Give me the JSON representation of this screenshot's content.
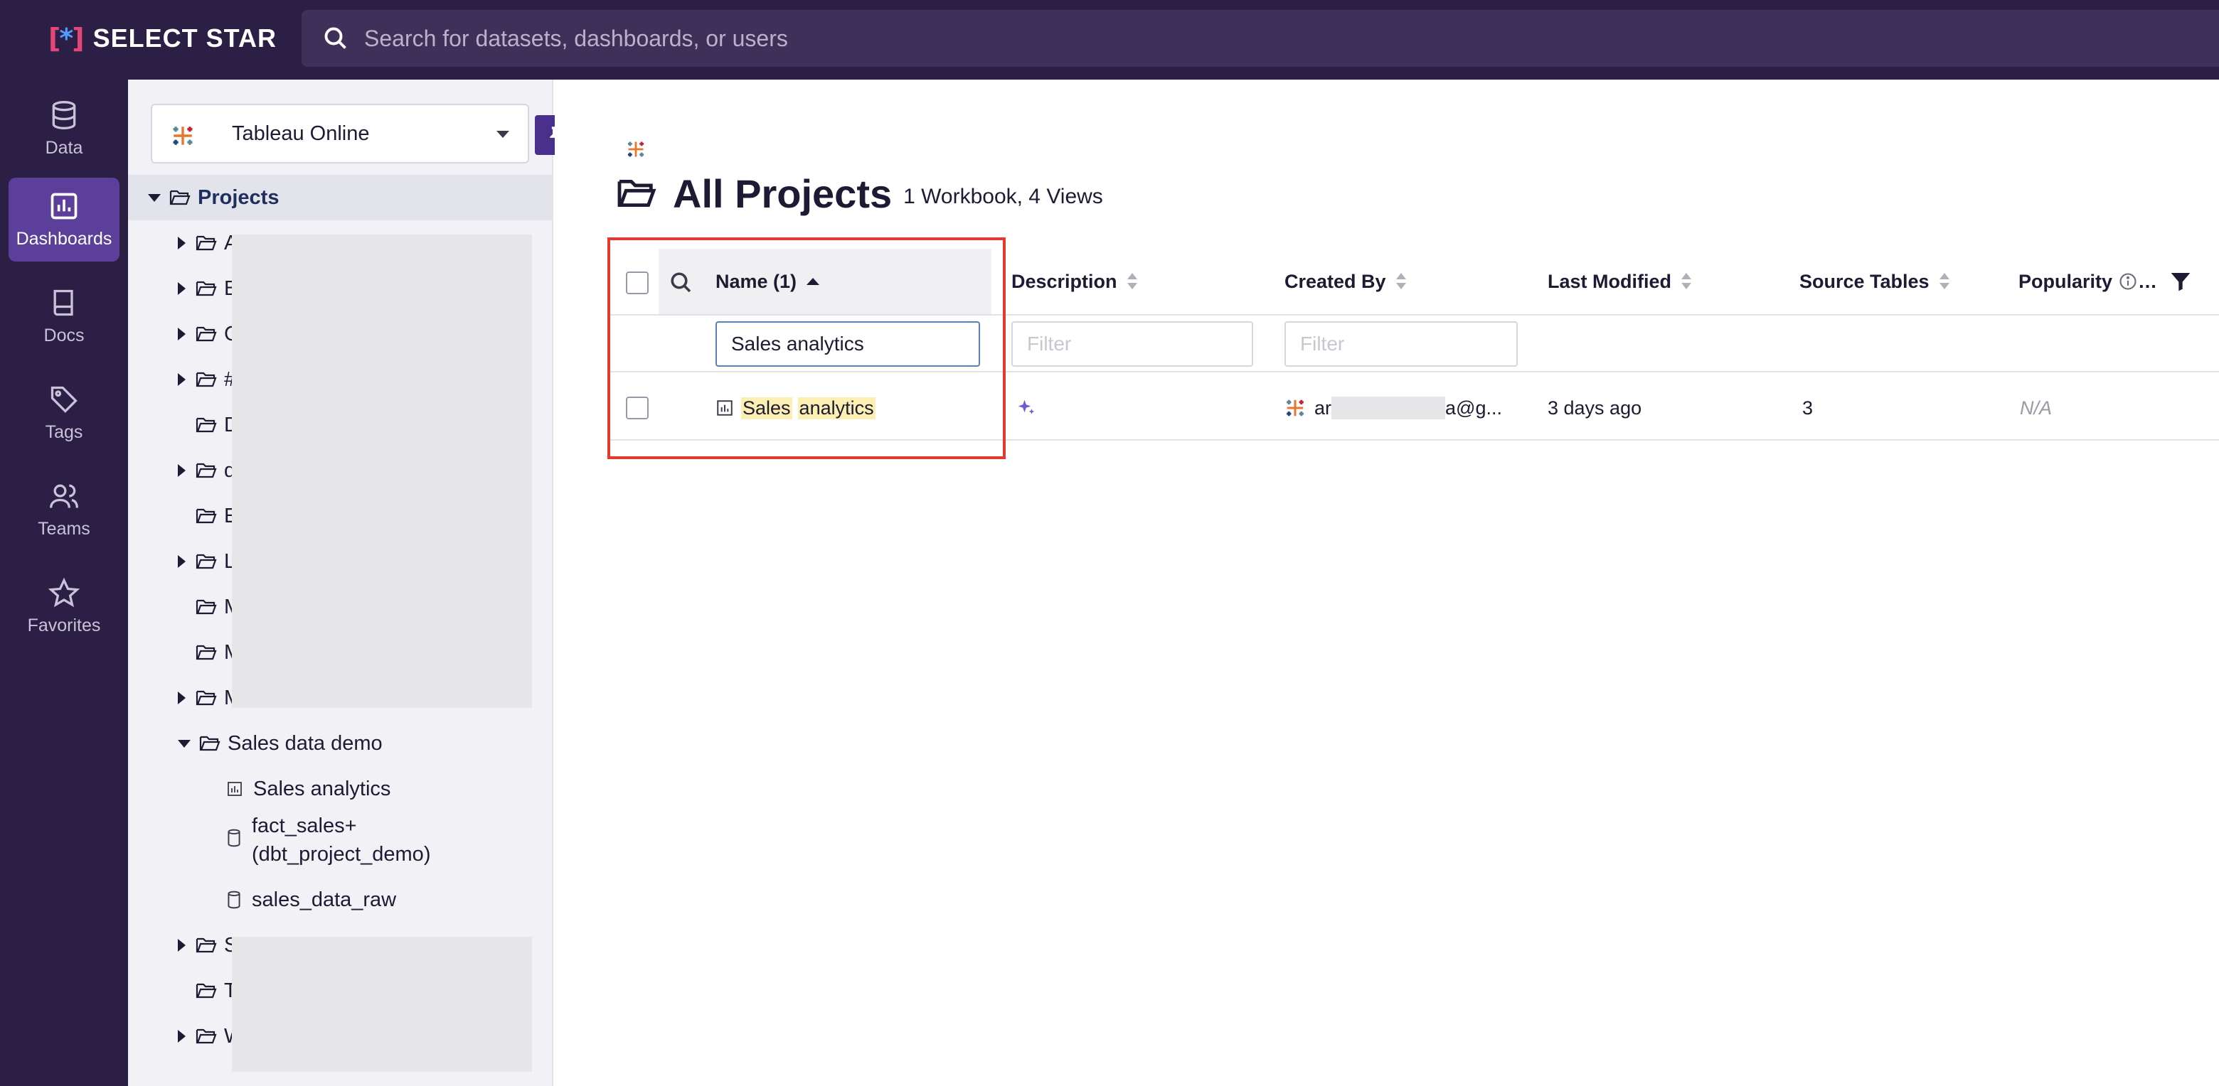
{
  "app": {
    "brand": "SELECT STAR",
    "brand_mark": "[*]"
  },
  "search": {
    "placeholder": "Search for datasets, dashboards, or users"
  },
  "nav": [
    {
      "label": "Data",
      "icon": "database-icon"
    },
    {
      "label": "Dashboards",
      "icon": "dashboard-icon",
      "active": true
    },
    {
      "label": "Docs",
      "icon": "book-icon"
    },
    {
      "label": "Tags",
      "icon": "tag-icon"
    },
    {
      "label": "Teams",
      "icon": "team-icon"
    },
    {
      "label": "Favorites",
      "icon": "star-icon"
    }
  ],
  "sidebar": {
    "source": "Tableau Online",
    "root": "Projects",
    "folders": [
      "A",
      "B",
      "C",
      "#",
      "D",
      "d",
      "E",
      "L",
      "M",
      "M",
      "M"
    ],
    "expanded_folder": "Sales data demo",
    "children": [
      "Sales analytics",
      "fact_sales+\n(dbt_project_demo)",
      "sales_data_raw"
    ],
    "folders_after": [
      "S",
      "T",
      "W"
    ]
  },
  "main": {
    "title": "All Projects",
    "meta": "1 Workbook, 4 Views",
    "columns": {
      "name": "Name (1)",
      "description": "Description",
      "created_by": "Created By",
      "last_modified": "Last Modified",
      "source_tables": "Source Tables",
      "popularity": "Popularity"
    },
    "filters": {
      "name_value": "Sales analytics",
      "description_placeholder": "Filter",
      "created_by_placeholder": "Filter"
    },
    "row": {
      "name_part1": "Sales",
      "name_part2": "analytics",
      "created_by_prefix": "ar",
      "created_by_suffix": "a@g...",
      "last_modified": "3 days ago",
      "source_tables": "3",
      "popularity": "N/A"
    }
  },
  "colors": {
    "topbar": "#2b1f45",
    "accent": "#5b3f9a",
    "highlight": "#fbefb2",
    "annotation": "#e23b2e"
  }
}
